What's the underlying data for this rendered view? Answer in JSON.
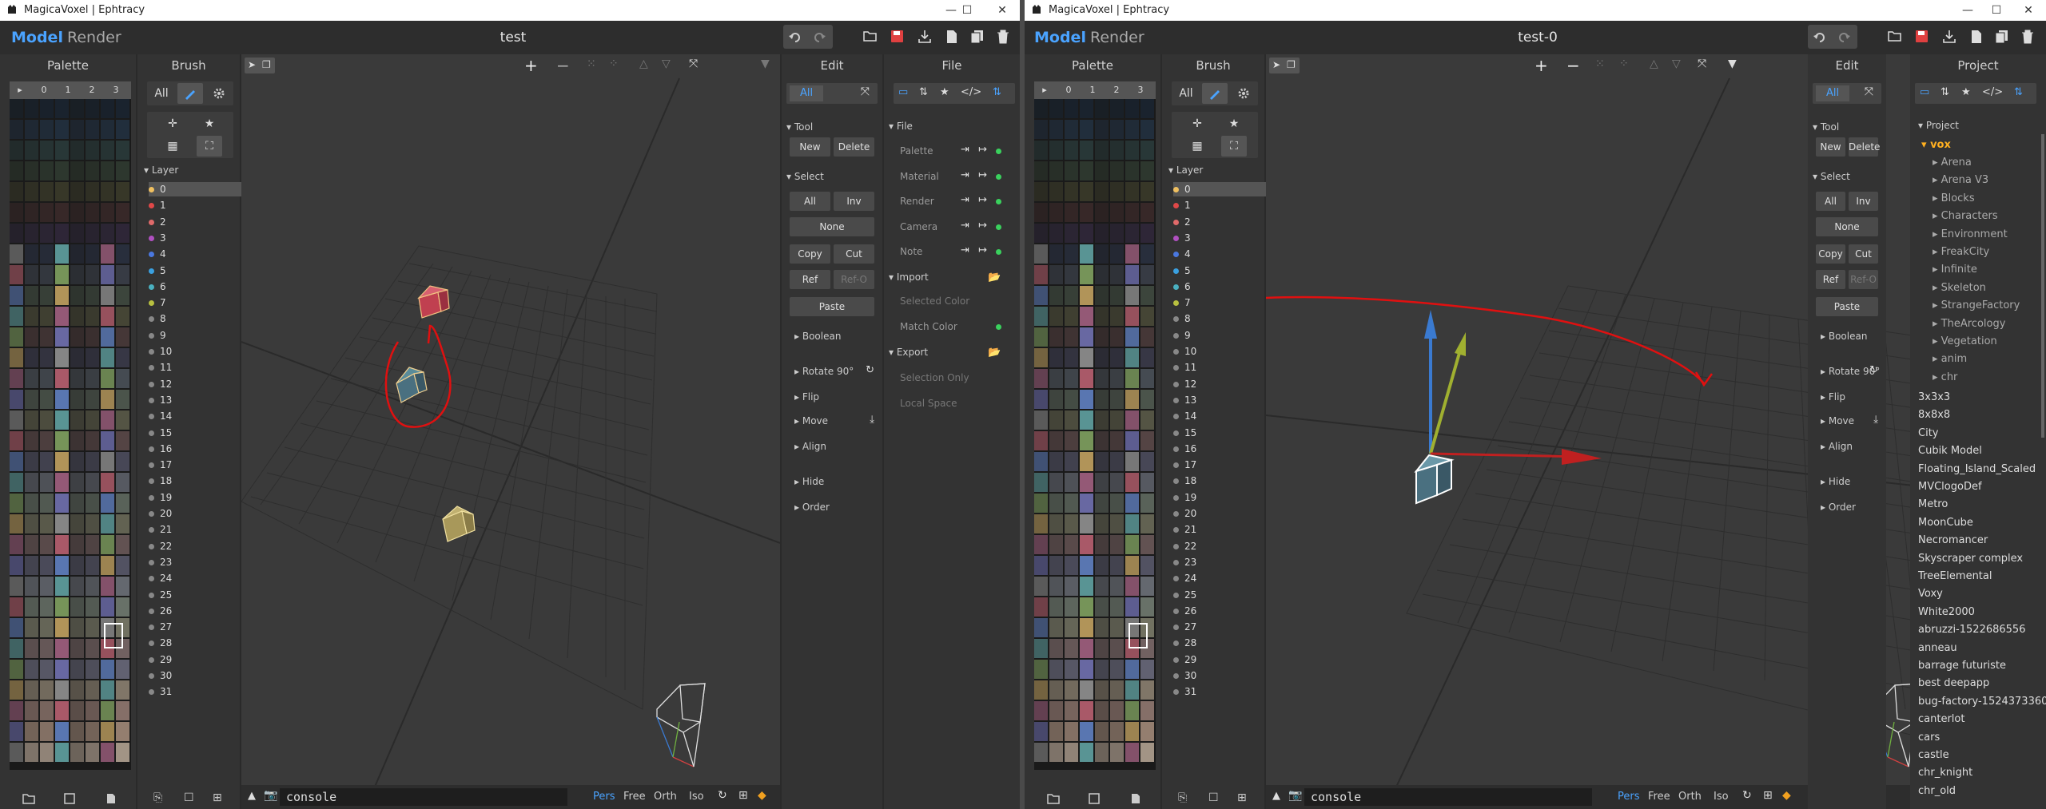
{
  "left": {
    "window_title": "MagicaVoxel | Ephtracy",
    "modes": [
      "Model",
      "Render"
    ],
    "doc_title": "test",
    "right_panel_title": "File",
    "file_section": {
      "title": "File",
      "rows": [
        "Palette",
        "Material",
        "Render",
        "Camera",
        "Note"
      ],
      "import_title": "Import",
      "import_rows": [
        "Selected Color",
        "Match Color"
      ],
      "export_title": "Export",
      "export_rows": [
        "Selection Only",
        "Local Space"
      ]
    }
  },
  "right": {
    "window_title": "MagicaVoxel | Ephtracy",
    "modes": [
      "Model",
      "Render"
    ],
    "doc_title": "test-0",
    "right_panel_title": "Project",
    "project": {
      "root": "Project",
      "folder": "vox",
      "subfolders": [
        "Arena",
        "Arena V3",
        "Blocks",
        "Characters",
        "Environment",
        "FreakCity",
        "Infinite",
        "Skeleton",
        "StrangeFactory",
        "TheArcology",
        "Vegetation",
        "anim",
        "chr"
      ],
      "files": [
        "3x3x3",
        "8x8x8",
        "City",
        "Cubik Model",
        "Floating_Island_Scaled",
        "MVClogoDef",
        "Metro",
        "MoonCube",
        "Necromancer",
        "Skyscraper complex",
        "TreeElemental",
        "Voxy",
        "White2000",
        "abruzzi-1522686556",
        "anneau",
        "barrage futuriste",
        "best deepapp",
        "bug-factory-1524373360",
        "canterlot",
        "cars",
        "castle",
        "chr_knight",
        "chr_old"
      ]
    }
  },
  "shared": {
    "palette_title": "Palette",
    "palette_tabs": [
      "▸",
      "0",
      "1",
      "2",
      "3"
    ],
    "brush_title": "Brush",
    "brush_all": "All",
    "layer_title": "Layer",
    "layers": [
      "0",
      "1",
      "2",
      "3",
      "4",
      "5",
      "6",
      "7",
      "8",
      "9",
      "10",
      "11",
      "12",
      "13",
      "14",
      "15",
      "16",
      "17",
      "18",
      "19",
      "20",
      "21",
      "22",
      "23",
      "24",
      "25",
      "26",
      "27",
      "28",
      "29",
      "30",
      "31"
    ],
    "layer_colors": [
      "#f0c060",
      "#e04848",
      "#e06a6a",
      "#b050c0",
      "#4a78e0",
      "#3aa0e0",
      "#4ab0c0",
      "#b8c040",
      "#888",
      "#888",
      "#888",
      "#888",
      "#888",
      "#888",
      "#888",
      "#888",
      "#888",
      "#888",
      "#888",
      "#888",
      "#888",
      "#888",
      "#888",
      "#888",
      "#888",
      "#888",
      "#888",
      "#888",
      "#888",
      "#888",
      "#888",
      "#888"
    ],
    "edit_title": "Edit",
    "edit_all": "All",
    "tool_title": "Tool",
    "tool_new": "New",
    "tool_delete": "Delete",
    "select_title": "Select",
    "select_all": "All",
    "select_inv": "Inv",
    "select_none": "None",
    "copy": "Copy",
    "cut": "Cut",
    "ref": "Ref",
    "ref_o": "Ref-O",
    "paste": "Paste",
    "boolean": "Boolean",
    "rotate": "Rotate 90°",
    "flip": "Flip",
    "move": "Move",
    "align": "Align",
    "hide": "Hide",
    "order": "Order",
    "console": "console",
    "view_modes": [
      "Pers",
      "Free",
      "Orth",
      "Iso"
    ],
    "accent": "#4aa3ff",
    "annotation_color": "#e01010"
  }
}
